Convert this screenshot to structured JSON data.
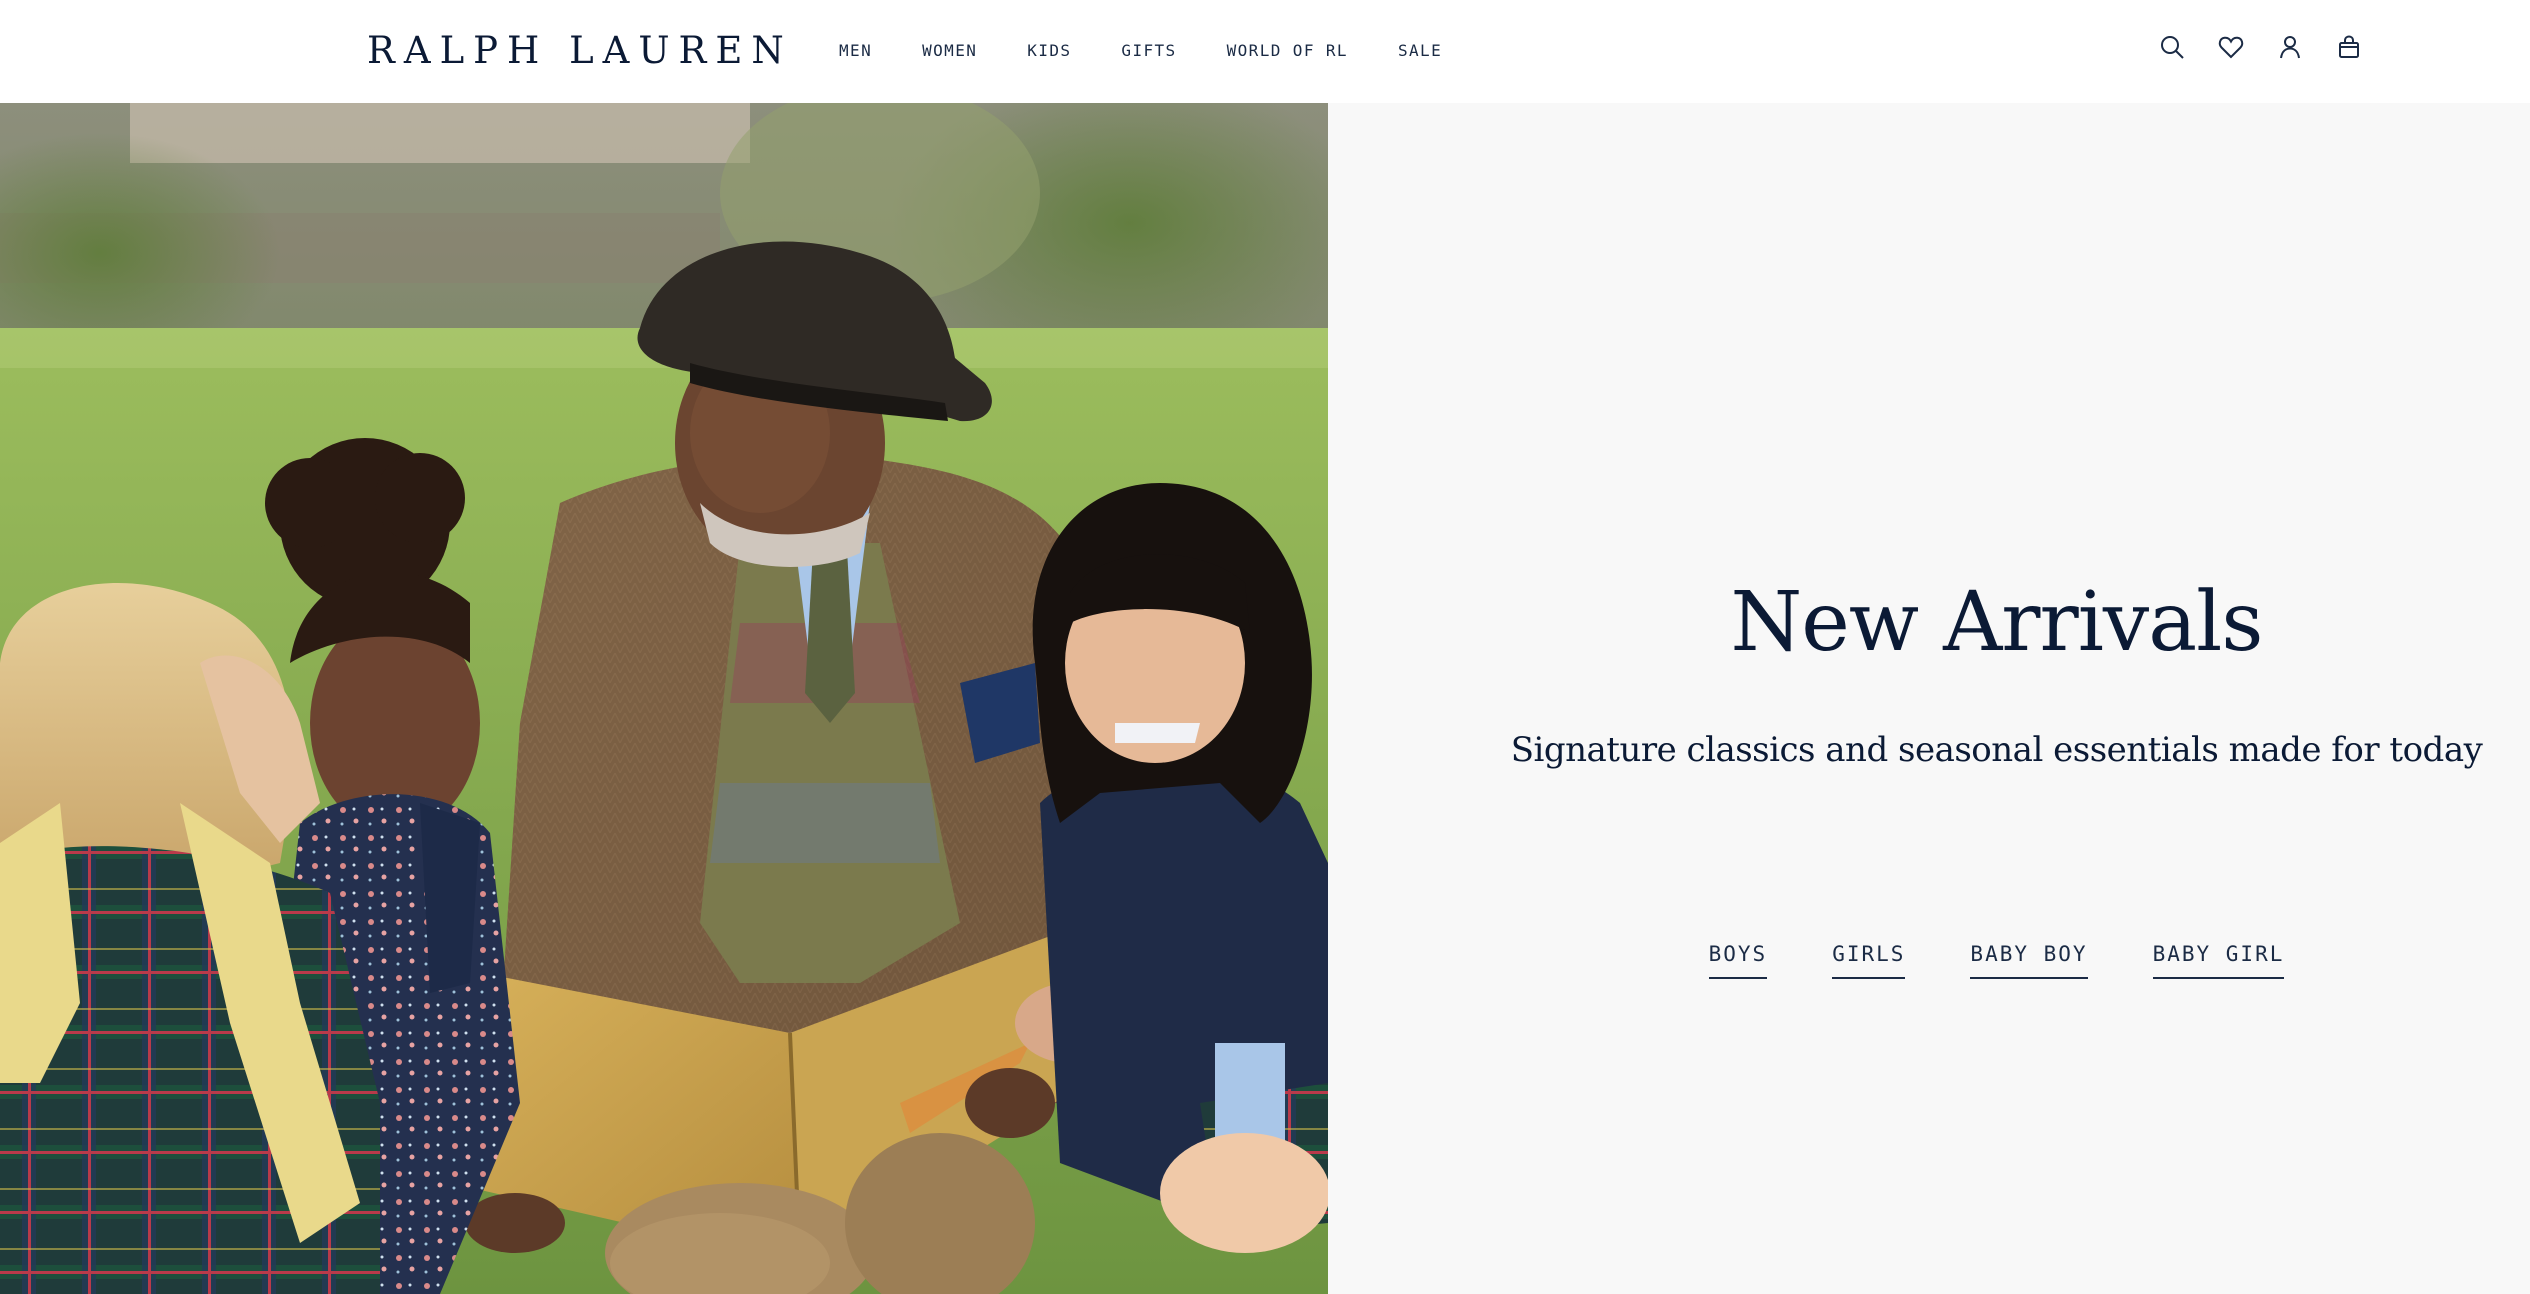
{
  "brand": {
    "logo_text": "RALPH LAUREN",
    "color": "#0b1a35"
  },
  "nav": {
    "items": [
      {
        "label": "MEN"
      },
      {
        "label": "WOMEN"
      },
      {
        "label": "KIDS"
      },
      {
        "label": "GIFTS"
      },
      {
        "label": "WORLD OF RL"
      },
      {
        "label": "SALE"
      }
    ]
  },
  "utility_icons": [
    "search-icon",
    "heart-icon",
    "account-icon",
    "shopping-bag-icon"
  ],
  "hero": {
    "image_subject": "family-reading-picnic-photo",
    "title": "New Arrivals",
    "subtitle": "Signature classics and seasonal essentials made for today",
    "panel_background": "#f8f8f8",
    "links": [
      {
        "label": "BOYS"
      },
      {
        "label": "GIRLS"
      },
      {
        "label": "BABY BOY"
      },
      {
        "label": "BABY GIRL"
      }
    ]
  }
}
